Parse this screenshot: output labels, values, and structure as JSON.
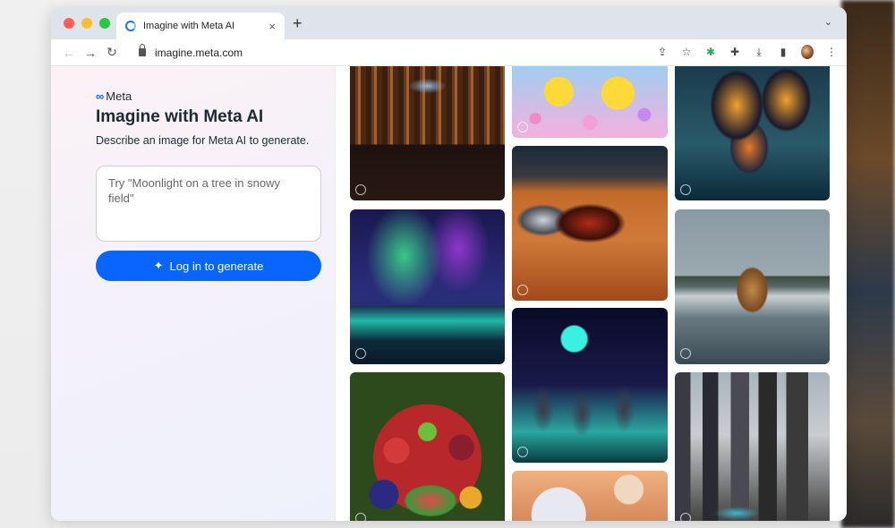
{
  "browser": {
    "tab_title": "Imagine with Meta AI",
    "tab_close": "×",
    "new_tab": "+",
    "tab_menu": "⌄",
    "url": "imagine.meta.com",
    "nav": {
      "back": "←",
      "forward": "→",
      "reload": "↻"
    },
    "toolbar_icons": {
      "share": "⇪",
      "bookmark": "☆",
      "extension_green": "✱",
      "extensions": "✚",
      "download": "⤓",
      "sidebar": "▮",
      "menu": "⋮"
    }
  },
  "brand": {
    "logo_glyph": "∞",
    "name": "Meta"
  },
  "hero": {
    "title": "Imagine with Meta AI",
    "subtitle": "Describe an image for Meta AI to generate."
  },
  "prompt": {
    "placeholder": "Try \"Moonlight on a tree in snowy field\""
  },
  "cta": {
    "sparkle": "✦",
    "label": "Log in to generate"
  },
  "gallery": {
    "tiles": [
      {
        "name": "library",
        "column": 1
      },
      {
        "name": "aurora",
        "column": 1
      },
      {
        "name": "fruit",
        "column": 1
      },
      {
        "name": "ducks",
        "column": 2
      },
      {
        "name": "desert-cars",
        "column": 2
      },
      {
        "name": "astronauts",
        "column": 2
      },
      {
        "name": "plush",
        "column": 2
      },
      {
        "name": "butterfly",
        "column": 3
      },
      {
        "name": "dog-in-water",
        "column": 3
      },
      {
        "name": "city",
        "column": 3
      }
    ]
  },
  "colors": {
    "accent": "#0866ff",
    "text": "#1c2b33",
    "tab_bar": "#dfe3ea"
  }
}
